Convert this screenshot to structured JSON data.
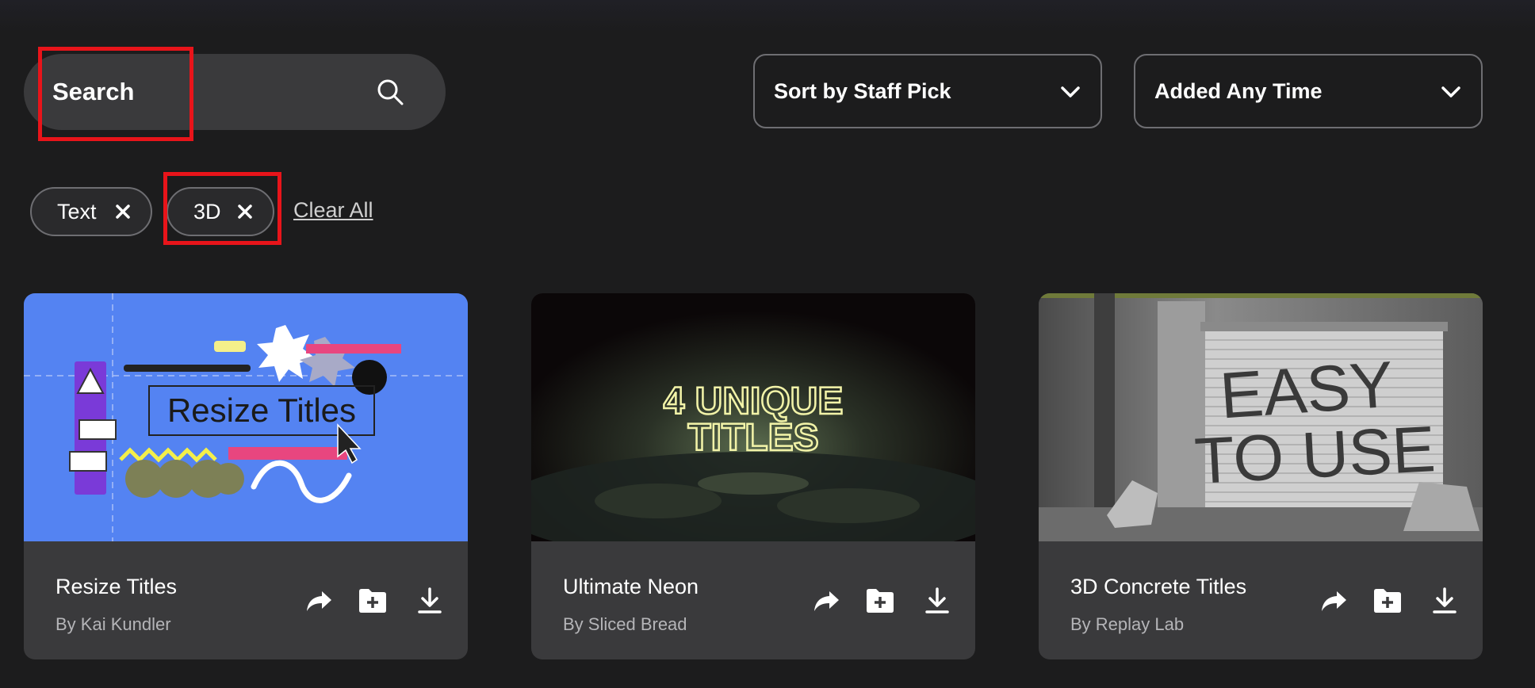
{
  "search": {
    "placeholder": "Search",
    "value": ""
  },
  "sort_dropdown": {
    "selected": "Sort by Staff Pick"
  },
  "time_dropdown": {
    "selected": "Added Any Time"
  },
  "filters": {
    "chips": [
      {
        "label": "Text"
      },
      {
        "label": "3D"
      }
    ],
    "clear_all_label": "Clear All"
  },
  "cards": [
    {
      "title": "Resize Titles",
      "author": "By Kai Kundler",
      "thumb_text": "Resize Titles"
    },
    {
      "title": "Ultimate Neon",
      "author": "By Sliced Bread",
      "thumb_text_line1": "4 UNIQUE",
      "thumb_text_line2": "TITLES"
    },
    {
      "title": "3D Concrete Titles",
      "author": "By Replay Lab",
      "thumb_text_line1": "EASY",
      "thumb_text_line2": "TO USE"
    }
  ],
  "icons": {
    "search": "search-icon",
    "chevron": "chevron-down-icon",
    "remove": "close-icon",
    "share": "share-icon",
    "folder": "folder-add-icon",
    "download": "download-icon"
  },
  "colors": {
    "background": "#1c1c1d",
    "card_info": "#3a3a3c",
    "highlight": "#e8141a",
    "card1_bg": "#5483f2",
    "neon": "#f2f3a8"
  }
}
